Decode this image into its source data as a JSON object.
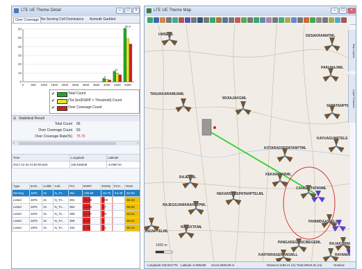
{
  "left_window": {
    "title": "LTE UE Theme Detail",
    "tabs": [
      "Over Coverage",
      "No Serving Cell Dominance",
      "Azimuth Garbled"
    ]
  },
  "chart_data": {
    "type": "bar",
    "title": "",
    "x_ticks": [
      0,
      500,
      1000,
      1500,
      2000,
      2500,
      3000,
      3500,
      4000,
      4500,
      5000
    ],
    "y_ticks": [
      0,
      10,
      20,
      30,
      40,
      50,
      60
    ],
    "xlim": [
      0,
      5300
    ],
    "ylim": [
      0,
      60
    ],
    "series": [
      {
        "name": "Total Count",
        "color": "#22aa22",
        "x": [
          4000,
          4500,
          5000
        ],
        "values": [
          4,
          12,
          61
        ]
      },
      {
        "name": "(Tot.Ser(RSRP > Threshold) Count",
        "color": "#e6e62a",
        "x": [
          4000,
          4500,
          5000
        ],
        "values": [
          3,
          10,
          49
        ]
      },
      {
        "name": "Over Coverage Count",
        "color": "#d42020",
        "x": [
          4000,
          4500,
          5000
        ],
        "values": [
          2,
          8,
          43
        ]
      }
    ],
    "data_labels": [
      "60.8",
      "12",
      "4"
    ]
  },
  "statistical_result": {
    "header": "Statistical Result",
    "rows": [
      {
        "label": "Total Count",
        "value": "66"
      },
      {
        "label": "Over Coverage Count",
        "value": "50"
      },
      {
        "label": "Over Coverage Rate(%)",
        "value": "75.76"
      }
    ]
  },
  "point_info": {
    "columns": [
      "Time",
      "Longitude",
      "Latitude"
    ],
    "values": [
      "2017-12-24 01:50:06.503",
      "106.526839",
      "-6.095710"
    ]
  },
  "cell_table": {
    "columns": [
      "Type",
      "EAR...",
      "CellID",
      "Cell...",
      "PCI",
      "RSRP",
      "RSRQ",
      "PCC...",
      "RSSI"
    ],
    "rows": [
      [
        "Serving",
        "1875",
        "31",
        "N_TA...",
        "251",
        "-125.55",
        "-15.76",
        "-13.40",
        "-62.00"
      ],
      [
        "Listed",
        "1875",
        "31",
        "N_TA...",
        "391",
        "-26.39",
        "8.00",
        "",
        "-68.38"
      ],
      [
        "Listed",
        "1875",
        "31",
        "N_TA...",
        "392",
        "-24.59",
        "-27",
        "",
        "-68.66"
      ],
      [
        "Listed",
        "1875",
        "31",
        "N_TA...",
        "390",
        "-11.00",
        "-19",
        "",
        "-69.64"
      ],
      [
        "Listed",
        "1875",
        "31",
        "N_TA...",
        "308",
        "-5.10",
        "-8",
        "",
        "-69.64"
      ],
      [
        "Listed",
        "1875",
        "31",
        "N_TA...",
        "194",
        "-7.75",
        "-21",
        "",
        "-69.44"
      ]
    ]
  },
  "map_window": {
    "title": "LTE UE Theme Map",
    "side_tabs": [
      "Map Layers",
      "Layer Features"
    ],
    "scale": "1000 m",
    "status": {
      "longitude": "Longitude:106.501776",
      "latitude": "Latitude:-6.085495",
      "zoom": "Zoom:6690.89 m",
      "distance": "Distance:1188.21 (m) Total:20943.81 (m)",
      "mode": "Outdoor"
    },
    "site_labels": [
      "DESAKRAMATML",
      "PAKUHAJIML",
      "TANJAKARAMUAML",
      "WIJIAJAKGML",
      "SEPATANPTELML",
      "KAYUAGUNPTELE",
      "KOTARADSEPATANPTML",
      "KEKARJAYAML",
      "CANGALTATANML",
      "RAJEGML",
      "NEKARSABEPATANPTELML",
      "RAJEGSJAMANAHSTPML",
      "RAJEKTKML",
      "TNGNPTELML",
      "PANIMDAASJELE",
      "RAJAKCAWARML",
      "PANGADEGANCIBEGEML",
      "KARTARAGERANGMLL",
      "RAYAMAML",
      "UMSEML"
    ]
  },
  "colors": {
    "serving_row": "#1f7fc7",
    "rsrp_bar": "#e62020",
    "rssi_bar": "#f0c000",
    "route": "#2bd12b",
    "sector": "#5a3a1a",
    "coverage_circle": "#d23030"
  }
}
